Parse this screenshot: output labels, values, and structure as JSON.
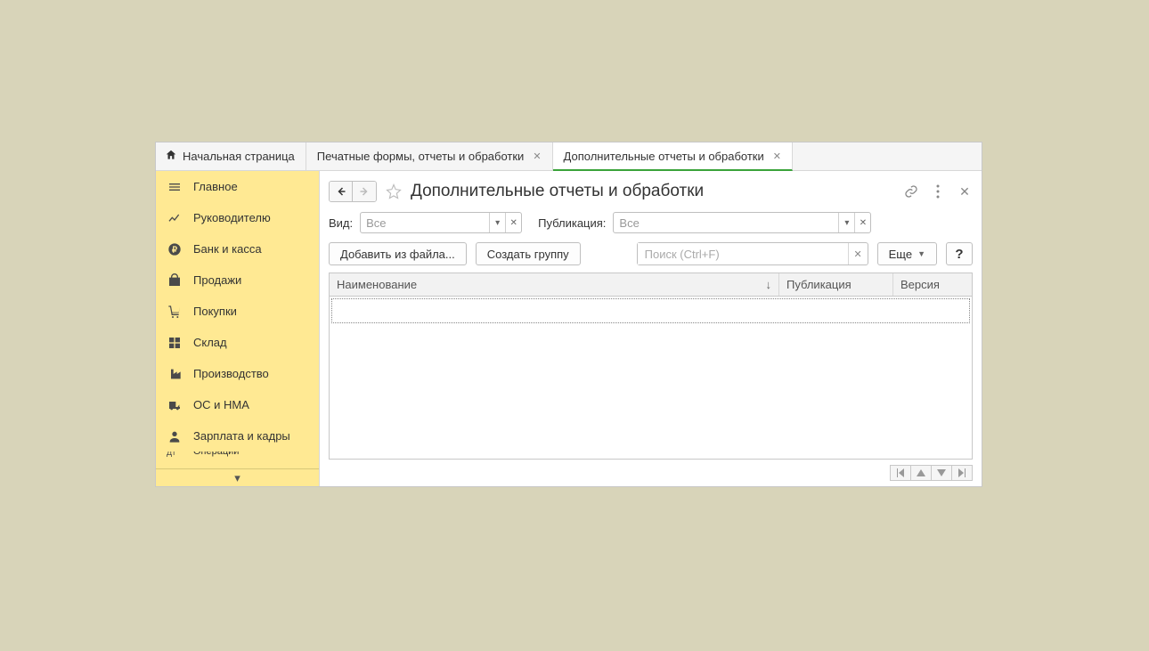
{
  "tabs": {
    "home": "Начальная страница",
    "tab1": "Печатные формы, отчеты и обработки",
    "tab2": "Дополнительные отчеты и обработки"
  },
  "sidebar": {
    "items": [
      {
        "label": "Главное",
        "icon": "menu"
      },
      {
        "label": "Руководителю",
        "icon": "chart"
      },
      {
        "label": "Банк и касса",
        "icon": "ruble"
      },
      {
        "label": "Продажи",
        "icon": "bag"
      },
      {
        "label": "Покупки",
        "icon": "cart"
      },
      {
        "label": "Склад",
        "icon": "boxes"
      },
      {
        "label": "Производство",
        "icon": "factory"
      },
      {
        "label": "ОС и НМА",
        "icon": "truck"
      },
      {
        "label": "Зарплата и кадры",
        "icon": "person"
      }
    ],
    "partial": "Операции"
  },
  "page": {
    "title": "Дополнительные отчеты и обработки"
  },
  "filters": {
    "kind_label": "Вид:",
    "kind_value": "Все",
    "pub_label": "Публикация:",
    "pub_value": "Все"
  },
  "actions": {
    "add_from_file": "Добавить из файла...",
    "create_group": "Создать группу",
    "more": "Еще",
    "help": "?"
  },
  "search": {
    "placeholder": "Поиск (Ctrl+F)"
  },
  "table": {
    "col_name": "Наименование",
    "col_pub": "Публикация",
    "col_ver": "Версия"
  }
}
